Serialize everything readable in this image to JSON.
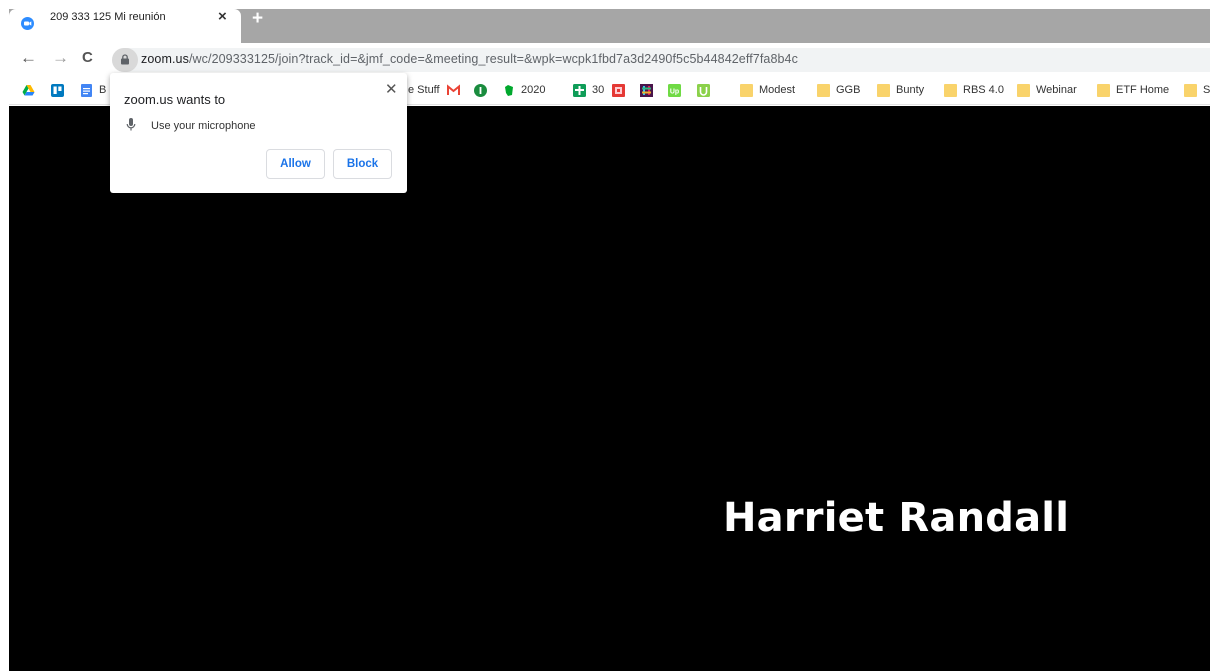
{
  "tab": {
    "title": "209 333 125 Mi reunión",
    "close": "×",
    "new_tab": "+"
  },
  "nav": {
    "back": "←",
    "forward": "→",
    "reload": "C"
  },
  "address": {
    "host": "zoom.us",
    "path": "/wc/209333125/join?track_id=&jmf_code=&meeting_result=&wpk=wcpk1fbd7a3d2490f5c5b44842eff7fa8b4c"
  },
  "bookmarks": [
    {
      "label": "",
      "icon": "google-drive-icon"
    },
    {
      "label": "",
      "icon": "trello-icon"
    },
    {
      "label": "B",
      "icon": "google-docs-icon"
    },
    {
      "label": "e Stuff",
      "icon": ""
    },
    {
      "label": "",
      "icon": "gmail-icon"
    },
    {
      "label": "",
      "icon": "1password-icon"
    },
    {
      "label": "2020",
      "icon": "evernote-icon"
    },
    {
      "label": "30",
      "icon": "google-sheets-icon"
    },
    {
      "label": "",
      "icon": "red-bookmark-icon"
    },
    {
      "label": "",
      "icon": "slack-icon"
    },
    {
      "label": "",
      "icon": "upwork-icon"
    },
    {
      "label": "",
      "icon": "green-u-icon"
    },
    {
      "label": "Modest",
      "icon": "folder-icon"
    },
    {
      "label": "GGB",
      "icon": "folder-icon"
    },
    {
      "label": "Bunty",
      "icon": "folder-icon"
    },
    {
      "label": "RBS 4.0",
      "icon": "folder-icon"
    },
    {
      "label": "Webinar",
      "icon": "folder-icon"
    },
    {
      "label": "ETF Home",
      "icon": "folder-icon"
    },
    {
      "label": "S",
      "icon": "folder-icon"
    }
  ],
  "popup": {
    "title": "zoom.us wants to",
    "permission": "Use your microphone",
    "close": "✕",
    "allow_label": "Allow",
    "block_label": "Block"
  },
  "meeting": {
    "participant_name": "Harriet Randall"
  },
  "colors": {
    "accent": "#1a73e8",
    "folder": "#f9d36b",
    "stage": "#000000",
    "tabstrip": "#a6a6a6"
  }
}
